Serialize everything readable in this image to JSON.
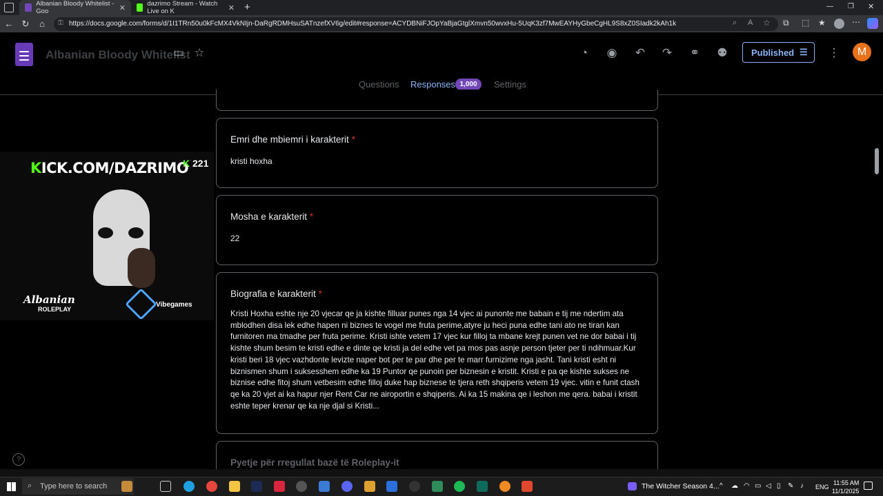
{
  "browser": {
    "tabs": [
      {
        "label": "Albanian Bloody Whitelist - Goo",
        "active": true
      },
      {
        "label": "dazrimo Stream - Watch Live on K",
        "active": false
      }
    ],
    "url": "https://docs.google.com/forms/d/1I1TRn50u0kFcMX4VkNIjn-DaRgRDMHsuSATnzefXV6g/edit#response=ACYDBNiFJOpYaBjaGtglXmvn50wvxHu-5UqK3zf7MwEAYHyGbeCgHL9S8xZ0SIadk2kAh1k"
  },
  "form": {
    "title": "Albanian Bloody Whitelist",
    "publish_label": "Published",
    "avatar_letter": "M",
    "tabs": [
      "Questions",
      "Responses",
      "Settings"
    ],
    "responses_count": "1,000"
  },
  "questions": [
    {
      "title": "Emri dhe mbiemri i karakterit",
      "required": "*",
      "answer": "kristi hoxha"
    },
    {
      "title": "Mosha e karakterit",
      "required": "*",
      "answer": "22"
    },
    {
      "title": "Biografia e karakterit",
      "required": "*",
      "answer": "Kristi Hoxha eshte nje 20 vjecar qe ja kishte filluar punes nga 14 vjec ai punonte me babain e tij me ndertim ata mblodhen disa lek edhe hapen ni biznes te vogel me fruta perime,atyre ju heci puna edhe tani ato ne tiran kan furnitoren ma tmadhe per fruta perime. Kristi ishte vetem 17 vjec kur filloj ta mbane krejt punen vet ne dor babai i tij kishte shum besim te kristi edhe e dinte qe kristi ja del edhe vet pa mos pas asnje person tjeter per ti ndihmuar.Kur kristi beri 18 vjec vazhdonte levizte naper bot per te par dhe per te marr furnizime nga jasht. Tani kristi esht ni biznismen shum i suksesshem edhe ka 19 Puntor qe punoin per biznesin e kristit. Kristi e pa qe kishte sukses ne biznise edhe fitoj shum vetbesim edhe filloj duke hap biznese te tjera reth shqiperis vetem 19 vjec. vitin e funit ctash qe ka 20 vjet ai ka hapur njer Rent Car ne airoportin e shqiperis. Ai ka 15 makina qe i leshon me qera. babai i kristit eshte teper krenar qe ka nje djal si Kristi..."
    },
    {
      "title": "Pyetje për rregullat bazë të Roleplay-it",
      "required": "",
      "answer": ""
    }
  ],
  "overlay": {
    "kick_prefix": "K",
    "kick_text": "ICK.COM/DAZRIMO",
    "viewers_icon": "K",
    "viewers": "221",
    "brand1": "Albanian",
    "brand1_sub": "ROLEPLAY",
    "brand2": "Vibegames"
  },
  "taskbar": {
    "search_placeholder": "Type here to search",
    "media_title": "The Witcher Season 4...",
    "lang": "ENG",
    "time": "11:55 AM",
    "date": "11/1/2025"
  }
}
